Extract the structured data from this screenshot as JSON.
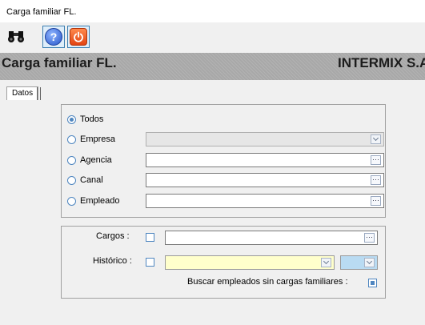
{
  "window": {
    "title": "Carga familiar FL."
  },
  "toolbar": {
    "buttons": [
      {
        "icon": "binoculars-icon",
        "label": ""
      },
      {
        "icon": "help-icon",
        "label": "?"
      },
      {
        "icon": "power-icon",
        "label": ""
      }
    ]
  },
  "header": {
    "title": "Carga familiar FL.",
    "company": "INTERMIX S.A"
  },
  "tabs": [
    {
      "label": "Datos"
    }
  ],
  "filter": {
    "options": [
      {
        "label": "Todos",
        "selected": true
      },
      {
        "label": "Empresa",
        "selected": false,
        "value": ""
      },
      {
        "label": "Agencia",
        "selected": false,
        "value": ""
      },
      {
        "label": "Canal",
        "selected": false,
        "value": ""
      },
      {
        "label": "Empleado",
        "selected": false,
        "value": ""
      }
    ]
  },
  "options": {
    "cargos_label": "Cargos :",
    "cargos_value": "",
    "historico_label": "Histórico :",
    "historico_value": "",
    "buscar_label": "Buscar empleados sin cargas familiares :"
  },
  "colors": {
    "banner": "#a8a8a8",
    "accent": "#4f86c0",
    "historico_field": "#ffffcc",
    "historico_period": "#b9dbf2"
  }
}
